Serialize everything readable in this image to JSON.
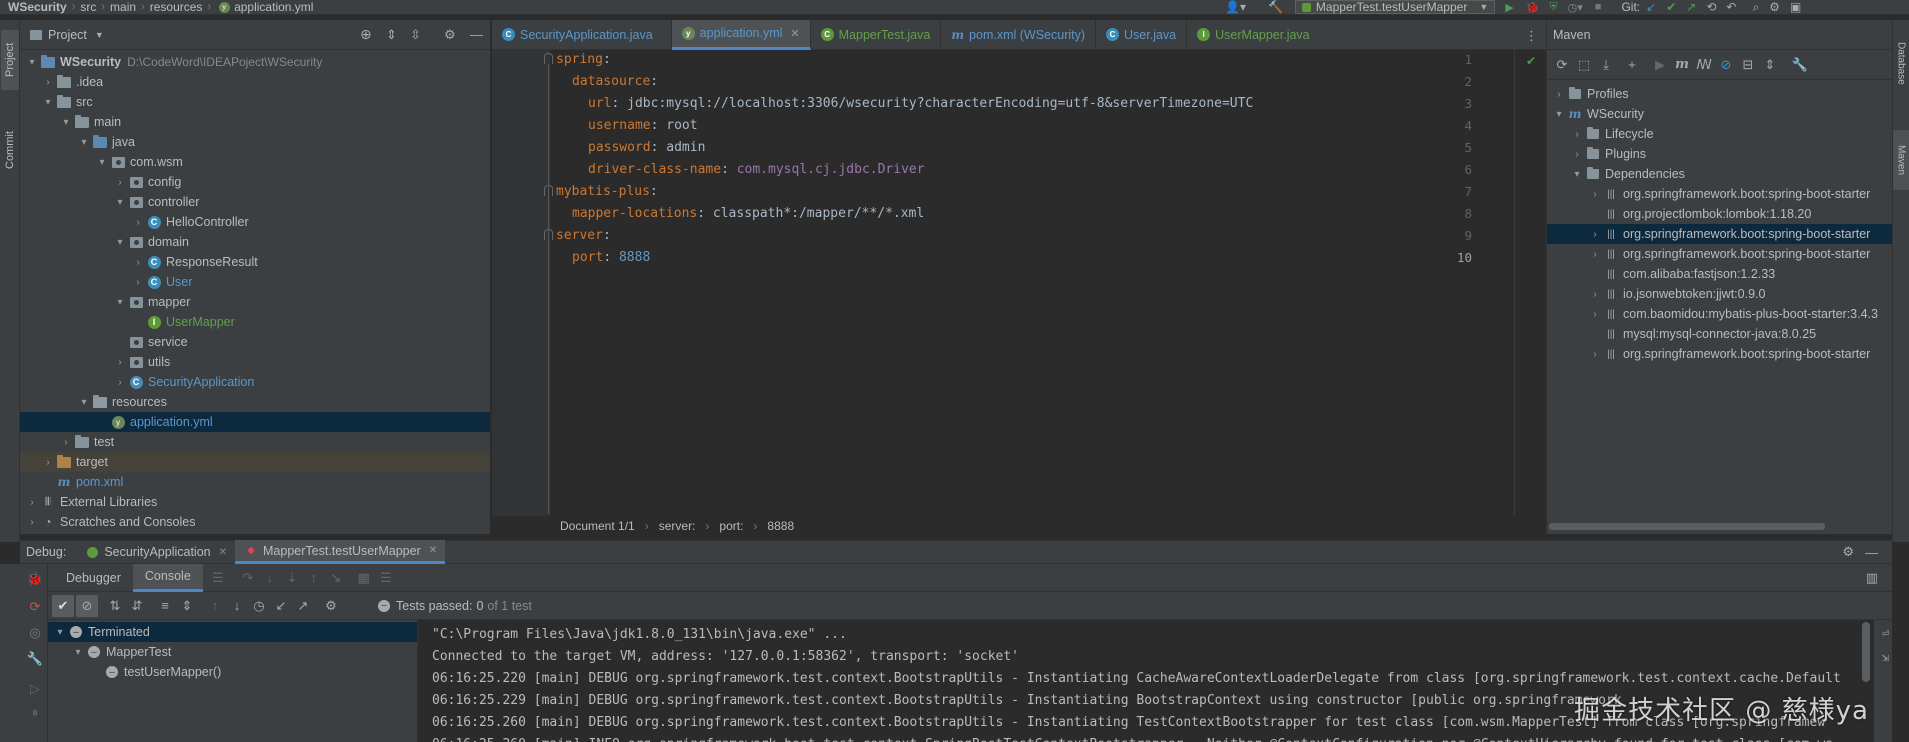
{
  "navbar": {
    "project": "WSecurity",
    "crumbs": [
      "src",
      "main",
      "resources",
      "application.yml"
    ],
    "run_config": "MapperTest.testUserMapper",
    "git_label": "Git:"
  },
  "left_stripe": {
    "project_tab": "Project",
    "commit_tab": "Commit"
  },
  "right_stripe": {
    "database_tab": "Database",
    "maven_tab": "Maven"
  },
  "project": {
    "title": "Project",
    "tree": [
      {
        "label": "WSecurity",
        "path": "D:\\CodeWord\\IDEAPoject\\WSecurity"
      },
      {
        "label": ".idea"
      },
      {
        "label": "src"
      },
      {
        "label": "main"
      },
      {
        "label": "java"
      },
      {
        "label": "com.wsm"
      },
      {
        "label": "config"
      },
      {
        "label": "controller"
      },
      {
        "label": "HelloController"
      },
      {
        "label": "domain"
      },
      {
        "label": "ResponseResult"
      },
      {
        "label": "User"
      },
      {
        "label": "mapper"
      },
      {
        "label": "UserMapper"
      },
      {
        "label": "service"
      },
      {
        "label": "utils"
      },
      {
        "label": "SecurityApplication"
      },
      {
        "label": "resources"
      },
      {
        "label": "application.yml"
      },
      {
        "label": "test"
      },
      {
        "label": "target"
      },
      {
        "label": "pom.xml"
      },
      {
        "label": "External Libraries"
      },
      {
        "label": "Scratches and Consoles"
      }
    ]
  },
  "editor": {
    "tabs": [
      {
        "label": "SecurityApplication.java"
      },
      {
        "label": "application.yml"
      },
      {
        "label": "MapperTest.java"
      },
      {
        "label": "pom.xml (WSecurity)"
      },
      {
        "label": "User.java"
      },
      {
        "label": "UserMapper.java"
      }
    ],
    "lines": [
      {
        "n": "1",
        "key": "spring",
        "val": ""
      },
      {
        "n": "2",
        "key": "datasource",
        "val": ""
      },
      {
        "n": "3",
        "key": "url",
        "val": "jdbc:mysql://localhost:3306/wsecurity?characterEncoding=utf-8&serverTimezone=UTC"
      },
      {
        "n": "4",
        "key": "username",
        "val": "root"
      },
      {
        "n": "5",
        "key": "password",
        "val": "admin"
      },
      {
        "n": "6",
        "key": "driver-class-name",
        "val": "com.mysql.cj.jdbc.Driver"
      },
      {
        "n": "7",
        "key": "mybatis-plus",
        "val": ""
      },
      {
        "n": "8",
        "key": "mapper-locations",
        "val": "classpath*:/mapper/**/*.xml"
      },
      {
        "n": "9",
        "key": "server",
        "val": ""
      },
      {
        "n": "10",
        "key": "port",
        "val": "8888"
      }
    ],
    "status": {
      "document": "Document 1/1",
      "path": [
        "server:",
        "port:",
        "8888"
      ]
    }
  },
  "maven": {
    "title": "Maven",
    "tree": [
      {
        "label": "Profiles"
      },
      {
        "label": "WSecurity"
      },
      {
        "label": "Lifecycle"
      },
      {
        "label": "Plugins"
      },
      {
        "label": "Dependencies"
      },
      {
        "label": "org.springframework.boot:spring-boot-starter"
      },
      {
        "label": "org.projectlombok:lombok:1.18.20"
      },
      {
        "label": "org.springframework.boot:spring-boot-starter"
      },
      {
        "label": "org.springframework.boot:spring-boot-starter"
      },
      {
        "label": "com.alibaba:fastjson:1.2.33"
      },
      {
        "label": "io.jsonwebtoken:jjwt:0.9.0"
      },
      {
        "label": "com.baomidou:mybatis-plus-boot-starter:3.4.3"
      },
      {
        "label": "mysql:mysql-connector-java:8.0.25"
      },
      {
        "label": "org.springframework.boot:spring-boot-starter"
      }
    ]
  },
  "debug": {
    "label": "Debug:",
    "sessions": [
      "SecurityApplication",
      "MapperTest.testUserMapper"
    ],
    "tabs": [
      "Debugger",
      "Console"
    ],
    "tests_passed_label": "Tests passed:",
    "tests_passed_count": "0",
    "tests_passed_total": "of 1 test",
    "test_tree": [
      {
        "label": "Terminated"
      },
      {
        "label": "MapperTest"
      },
      {
        "label": "testUserMapper()"
      }
    ],
    "console": [
      "\"C:\\Program Files\\Java\\jdk1.8.0_131\\bin\\java.exe\" ...",
      "Connected to the target VM, address: '127.0.0.1:58362', transport: 'socket'",
      "06:16:25.220 [main] DEBUG org.springframework.test.context.BootstrapUtils - Instantiating CacheAwareContextLoaderDelegate from class [org.springframework.test.context.cache.Default",
      "06:16:25.229 [main] DEBUG org.springframework.test.context.BootstrapUtils - Instantiating BootstrapContext using constructor [public org.springframework",
      "06:16:25.260 [main] DEBUG org.springframework.test.context.BootstrapUtils - Instantiating TestContextBootstrapper for test class [com.wsm.MapperTest] from class [org.springframew",
      "06:16:25.260 [main] INFO org.springframework.boot.test.context.SpringBootTestContextBootstrapper - Neither @ContextConfiguration nor @ContextHierarchy found for test class [com.ws"
    ]
  },
  "watermark": "掘金技术社区 @ 慈様ya",
  "colors": {
    "panel": "#3c3f41",
    "editor_bg": "#2b2b2b",
    "selection": "#0d293e",
    "accent": "#4a88c7",
    "yaml_key": "#cc7832",
    "number": "#6897bb"
  }
}
